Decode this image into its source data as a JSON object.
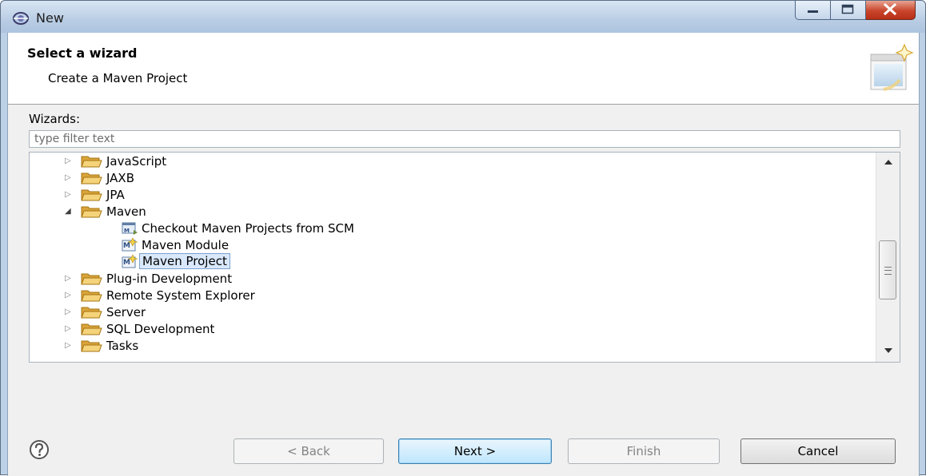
{
  "window": {
    "title": "New"
  },
  "header": {
    "title": "Select a wizard",
    "description": "Create a Maven Project"
  },
  "wizards_label": "Wizards:",
  "filter": {
    "placeholder": "type filter text",
    "value": ""
  },
  "tree": {
    "items": [
      {
        "label": "JavaScript",
        "type": "folder",
        "expanded": false
      },
      {
        "label": "JAXB",
        "type": "folder",
        "expanded": false
      },
      {
        "label": "JPA",
        "type": "folder",
        "expanded": false
      },
      {
        "label": "Maven",
        "type": "folder",
        "expanded": true
      },
      {
        "label": "Checkout Maven Projects from SCM",
        "type": "wizard",
        "icon": "maven-checkout-icon"
      },
      {
        "label": "Maven Module",
        "type": "wizard",
        "icon": "maven-module-icon"
      },
      {
        "label": "Maven Project",
        "type": "wizard",
        "icon": "maven-project-icon",
        "selected": true
      },
      {
        "label": "Plug-in Development",
        "type": "folder",
        "expanded": false
      },
      {
        "label": "Remote System Explorer",
        "type": "folder",
        "expanded": false
      },
      {
        "label": "Server",
        "type": "folder",
        "expanded": false
      },
      {
        "label": "SQL Development",
        "type": "folder",
        "expanded": false
      },
      {
        "label": "Tasks",
        "type": "folder",
        "expanded": false
      }
    ]
  },
  "buttons": {
    "back": "< Back",
    "next": "Next >",
    "finish": "Finish",
    "cancel": "Cancel"
  },
  "colors": {
    "selection": "#d9e8fb",
    "folder": "#e8b94a",
    "window_frame": "#bcd0e6"
  }
}
